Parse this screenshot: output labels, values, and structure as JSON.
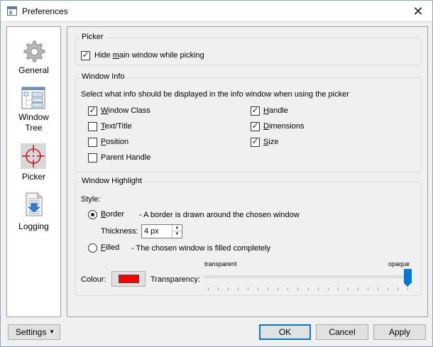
{
  "window": {
    "title": "Preferences",
    "close_glyph": "✕"
  },
  "sidebar": {
    "items": [
      {
        "label": "General",
        "icon": "gear-icon"
      },
      {
        "label": "Window\nTree",
        "line1": "Window",
        "line2": "Tree",
        "icon": "window-tree-icon"
      },
      {
        "label": "Picker",
        "icon": "crosshair-icon",
        "selected": true
      },
      {
        "label": "Logging",
        "icon": "log-document-icon"
      }
    ]
  },
  "picker_group": {
    "title": "Picker",
    "hide_main": {
      "label_pre": "Hide ",
      "label_u": "m",
      "label_post": "ain window while picking",
      "checked": true
    }
  },
  "info_group": {
    "title": "Window Info",
    "description": "Select what info should be displayed in the info window when using the picker",
    "left": [
      {
        "u": "W",
        "rest": "indow Class",
        "checked": true
      },
      {
        "u": "T",
        "rest": "ext/Title",
        "checked": false
      },
      {
        "u": "P",
        "rest": "osition",
        "checked": false
      },
      {
        "u": "",
        "rest": "Parent Handle",
        "checked": false
      }
    ],
    "right": [
      {
        "u": "H",
        "rest": "andle",
        "checked": true
      },
      {
        "u": "D",
        "rest": "imensions",
        "checked": true
      },
      {
        "u": "S",
        "rest": "ize",
        "checked": true
      }
    ]
  },
  "highlight_group": {
    "title": "Window Highlight",
    "style_label": "Style:",
    "border": {
      "u": "B",
      "rest": "order",
      "desc": "- A border is drawn around the chosen window",
      "selected": true
    },
    "thickness_label": "Thickness:",
    "thickness_value": "4 px",
    "filled": {
      "u": "F",
      "rest": "illed",
      "desc": "- The chosen window is filled completely",
      "selected": false
    },
    "colour_label": "Colour:",
    "colour_value": "#ff0000",
    "transparency_label": "Transparency:",
    "transparency_min": "transparent",
    "transparency_max": "opaque",
    "transparency_level": 1.0
  },
  "footer": {
    "settings": "Settings",
    "ok": "OK",
    "cancel": "Cancel",
    "apply": "Apply"
  },
  "colors": {
    "accent": "#0078d7",
    "selected_nav_bg": "#d8d8d8"
  }
}
